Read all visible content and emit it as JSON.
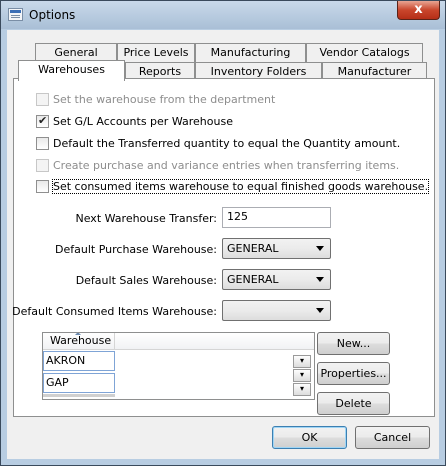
{
  "window": {
    "title": "Options",
    "close_glyph": "x"
  },
  "tabs": {
    "row1": [
      {
        "label": "General"
      },
      {
        "label": "Price Levels"
      },
      {
        "label": "Manufacturing"
      },
      {
        "label": "Vendor Catalogs"
      }
    ],
    "row2": [
      {
        "label": "Warehouses",
        "active": true
      },
      {
        "label": "Reports"
      },
      {
        "label": "Inventory Folders"
      },
      {
        "label": "Manufacturer"
      }
    ]
  },
  "options": [
    {
      "label": "Set the warehouse from the department",
      "checked": false,
      "enabled": false
    },
    {
      "label": "Set G/L Accounts per Warehouse",
      "checked": true,
      "enabled": true
    },
    {
      "label": "Default the Transferred quantity to equal the Quantity amount.",
      "checked": false,
      "enabled": true
    },
    {
      "label": "Create purchase and variance entries when transferring items.",
      "checked": false,
      "enabled": false
    },
    {
      "label": "Set consumed items warehouse to equal finished goods warehouse.",
      "checked": false,
      "enabled": true,
      "focused": true
    }
  ],
  "fields": {
    "next_transfer": {
      "label": "Next Warehouse Transfer:",
      "value": "125"
    },
    "purchase_wh": {
      "label": "Default Purchase Warehouse:",
      "value": "GENERAL"
    },
    "sales_wh": {
      "label": "Default Sales Warehouse:",
      "value": "GENERAL"
    },
    "consumed_wh": {
      "label": "Default Consumed Items Warehouse:",
      "value": ""
    }
  },
  "grid": {
    "column": "Warehouse",
    "rows": [
      "AKRON",
      "GAP"
    ]
  },
  "side_buttons": {
    "new": "New...",
    "properties": "Properties...",
    "delete": "Delete"
  },
  "footer": {
    "ok": "OK",
    "cancel": "Cancel"
  },
  "colors": {
    "title_bar": "#b8cde2",
    "close_button": "#c9462c",
    "default_button_border": "#3c7fb1"
  }
}
